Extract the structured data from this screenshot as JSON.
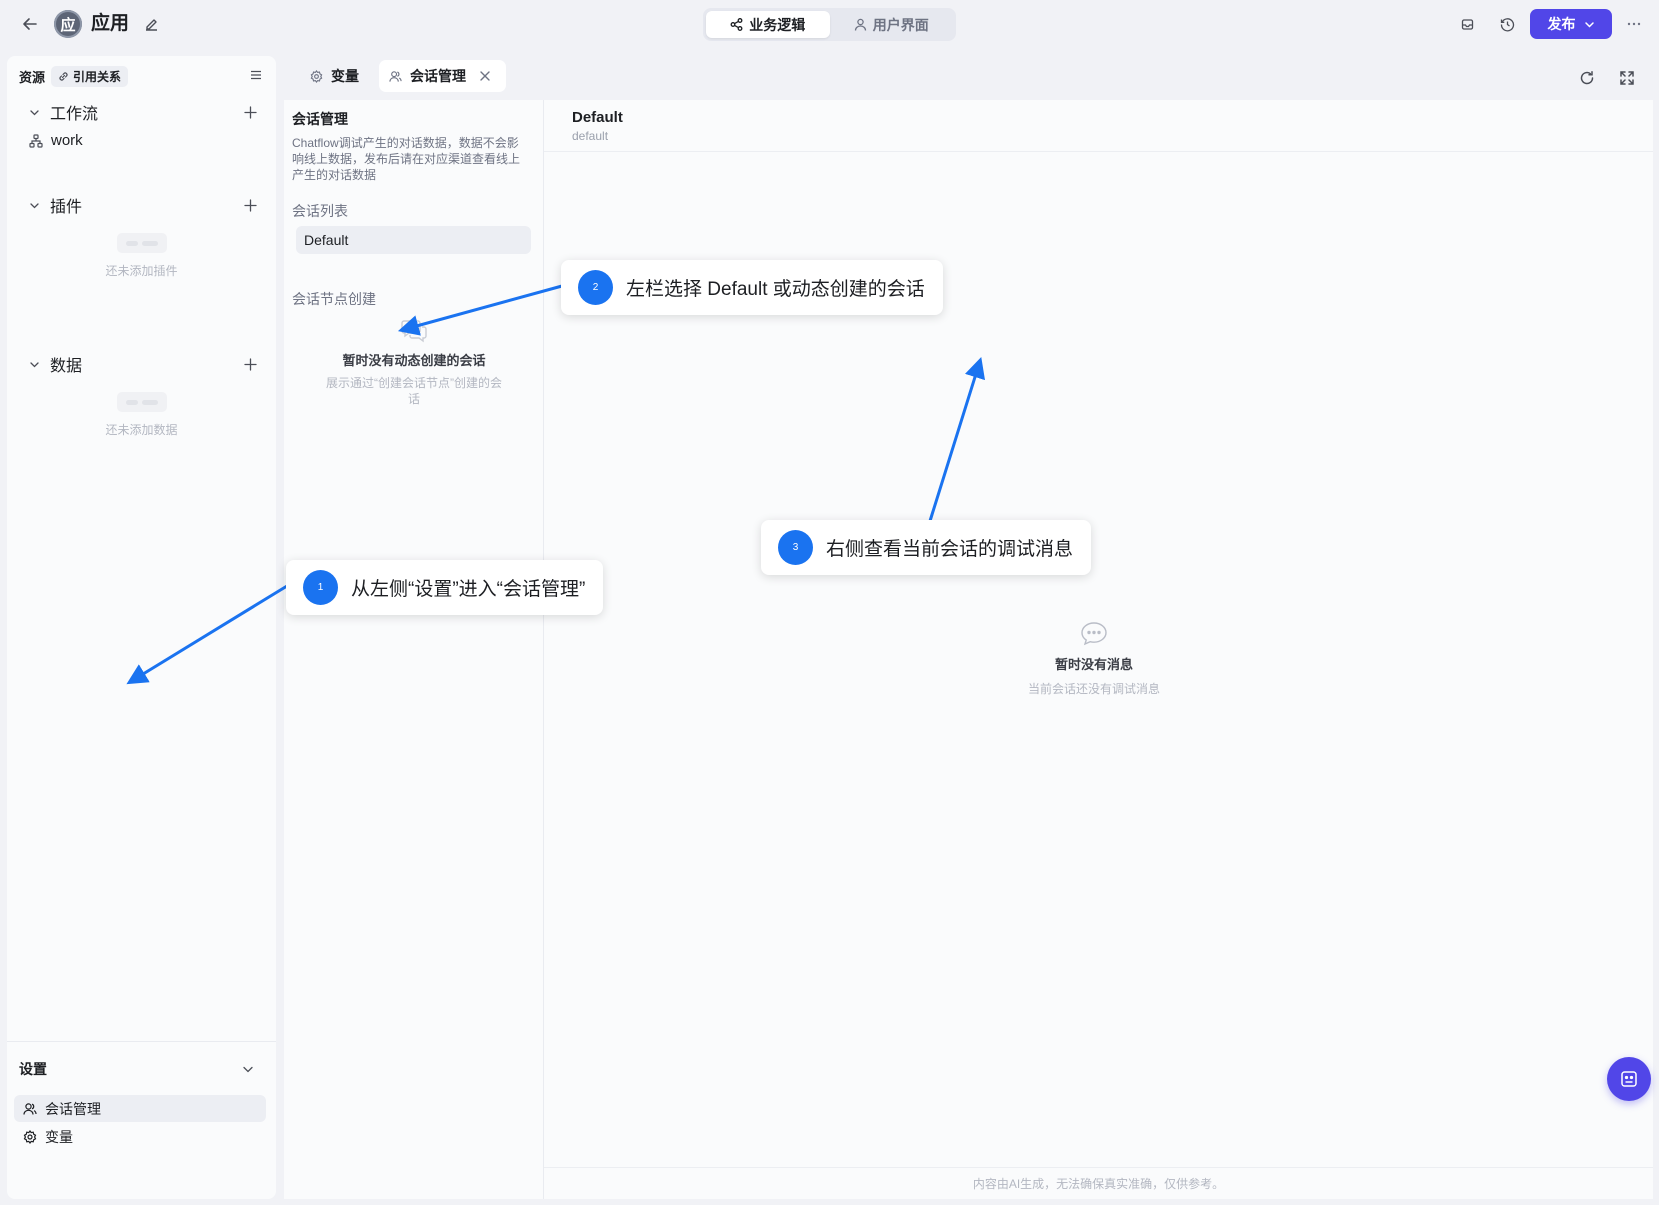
{
  "topbar": {
    "app_avatar": "应",
    "app_title": "应用",
    "mode_tabs": [
      {
        "label": "业务逻辑",
        "icon": "share-nodes-icon",
        "active": true
      },
      {
        "label": "用户界面",
        "icon": "user-icon",
        "active": false
      }
    ],
    "publish_label": "发布"
  },
  "sidebar": {
    "title": "资源",
    "ref_chip": "引用关系",
    "groups": {
      "workflow": {
        "label": "工作流",
        "items": [
          "work"
        ]
      },
      "plugins": {
        "label": "插件",
        "empty_text": "还未添加插件"
      },
      "data": {
        "label": "数据",
        "empty_text": "还未添加数据"
      }
    },
    "settings": {
      "label": "设置",
      "items": [
        {
          "label": "会话管理",
          "icon": "conversation-icon",
          "active": true
        },
        {
          "label": "变量",
          "icon": "gear-icon",
          "active": false
        }
      ]
    }
  },
  "tabs": [
    {
      "label": "变量",
      "icon": "gear-icon",
      "active": false
    },
    {
      "label": "会话管理",
      "icon": "conversation-icon",
      "active": true,
      "closable": true
    }
  ],
  "conversation_panel": {
    "title": "会话管理",
    "description": "Chatflow调试产生的对话数据，数据不会影响线上数据，发布后请在对应渠道查看线上产生的对话数据",
    "list_label": "会话列表",
    "list_items": [
      "Default"
    ],
    "node_label": "会话节点创建",
    "empty_title": "暂时没有动态创建的会话",
    "empty_sub": "展示通过“创建会话节点”创建的会话"
  },
  "message_panel": {
    "title": "Default",
    "subtitle": "default",
    "empty_title": "暂时没有消息",
    "empty_sub": "当前会话还没有调试消息",
    "footer": "内容由AI生成，无法确保真实准确，仅供参考。"
  },
  "callouts": [
    {
      "num": "1",
      "text": "从左侧“设置”进入“会话管理”"
    },
    {
      "num": "2",
      "text": "左栏选择 Default 或动态创建的会话"
    },
    {
      "num": "3",
      "text": "右侧查看当前会话的调试消息"
    }
  ],
  "colors": {
    "accent": "#5146e8",
    "annotation": "#1a73f0",
    "background": "#f1f2f6"
  }
}
